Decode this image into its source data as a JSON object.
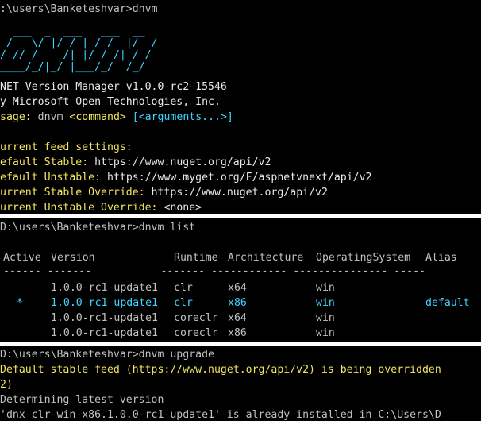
{
  "colors": {
    "background": "#000000",
    "text": "#c0c0c0",
    "yellow": "#f2e55e",
    "cyan": "#3fd5ff"
  },
  "panel1": {
    "prompt": ":\\users\\Banketeshvar>dnvm",
    "logo": [
      "  ___  _  ___   ___  __",
      " / _ \\/ |/ / | / /  |/  /",
      "/ // /    /| |/ / /|_/ /",
      "____/_/|_/ |___/_/  /_/"
    ],
    "version_line": "NET Version Manager v1.0.0-rc2-15546",
    "author_line": "y Microsoft Open Technologies, Inc.",
    "usage_label": "sage:",
    "usage_cmd": "dnvm",
    "usage_command": "<command>",
    "usage_args": "[<arguments...>]",
    "feed_header": "urrent feed settings:",
    "feeds": [
      {
        "label": "efault Stable:",
        "value": "https://www.nuget.org/api/v2"
      },
      {
        "label": "efault Unstable:",
        "value": "https://www.myget.org/F/aspnetvnext/api/v2"
      },
      {
        "label": "urrent Stable Override:",
        "value": "https://www.nuget.org/api/v2"
      },
      {
        "label": "urrent Unstable Override:",
        "value": "<none>"
      }
    ]
  },
  "panel2": {
    "prompt": "D:\\users\\Banketeshvar>dnvm list",
    "headers": {
      "active": "Active",
      "version": "Version",
      "runtime": "Runtime",
      "architecture": "Architecture",
      "os": "OperatingSystem",
      "alias": "Alias"
    },
    "separator": "------ -------           ------- ------------ --------------- -----",
    "rows": [
      {
        "active": "",
        "version": "1.0.0-rc1-update1",
        "runtime": "clr",
        "architecture": "x64",
        "os": "win",
        "alias": ""
      },
      {
        "active": "*",
        "version": "1.0.0-rc1-update1",
        "runtime": "clr",
        "architecture": "x86",
        "os": "win",
        "alias": "default"
      },
      {
        "active": "",
        "version": "1.0.0-rc1-update1",
        "runtime": "coreclr",
        "architecture": "x64",
        "os": "win",
        "alias": ""
      },
      {
        "active": "",
        "version": "1.0.0-rc1-update1",
        "runtime": "coreclr",
        "architecture": "x86",
        "os": "win",
        "alias": ""
      }
    ]
  },
  "panel3": {
    "prompt": "D:\\users\\Banketeshvar>dnvm upgrade",
    "warning": "Default stable feed (https://www.nuget.org/api/v2) is being overridden",
    "warning_cont": "2)",
    "determining": "Determining latest version",
    "installed": "'dnx-clr-win-x86.1.0.0-rc1-update1' is already installed in C:\\Users\\D"
  }
}
